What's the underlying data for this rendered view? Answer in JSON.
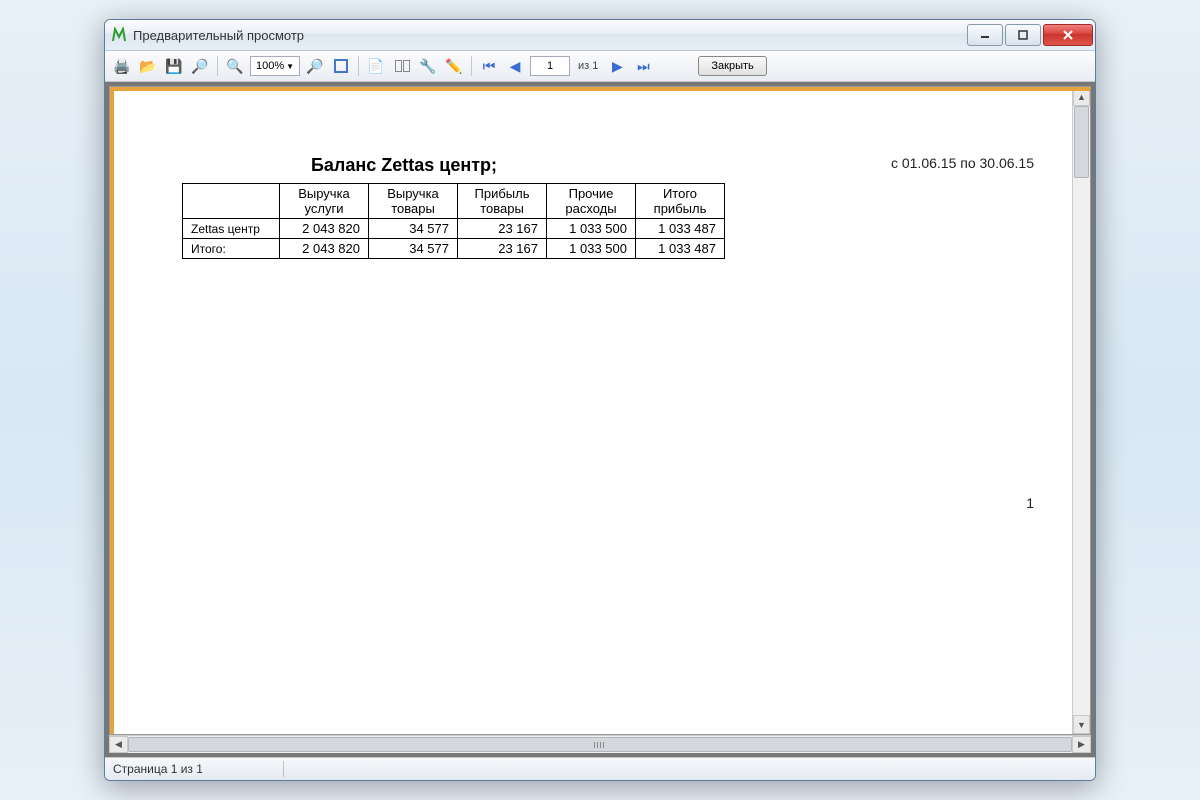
{
  "window": {
    "title": "Предварительный просмотр",
    "app_icon_letter": "M"
  },
  "toolbar": {
    "zoom_value": "100%",
    "page_current": "1",
    "page_total_label": "из 1",
    "close_label": "Закрыть"
  },
  "report": {
    "title": "Баланс Zettas центр;",
    "date_range": "с 01.06.15 по 30.06.15",
    "page_number": "1",
    "headers": [
      "",
      "Выручка услуги",
      "Выручка товары",
      "Прибыль товары",
      "Прочие расходы",
      "Итого прибыль"
    ],
    "rows": [
      {
        "label": "Zettas центр",
        "cells": [
          "2 043 820",
          "34 577",
          "23 167",
          "1 033 500",
          "1 033 487"
        ]
      },
      {
        "label": "Итого:",
        "cells": [
          "2 043 820",
          "34 577",
          "23 167",
          "1 033 500",
          "1 033 487"
        ]
      }
    ]
  },
  "statusbar": {
    "page_info": "Страница 1 из 1"
  },
  "icons": {
    "print": "print-icon",
    "open": "open-icon",
    "save": "save-icon",
    "find": "find-icon",
    "zoom_in": "zoom-in-icon",
    "zoom_out": "zoom-out-icon",
    "fullscreen": "fullscreen-icon",
    "outline": "outline-icon",
    "thumbnails": "thumbnails-icon",
    "settings": "settings-icon",
    "edit": "edit-icon",
    "first": "first-page-icon",
    "prev": "prev-page-icon",
    "next": "next-page-icon",
    "last": "last-page-icon"
  }
}
